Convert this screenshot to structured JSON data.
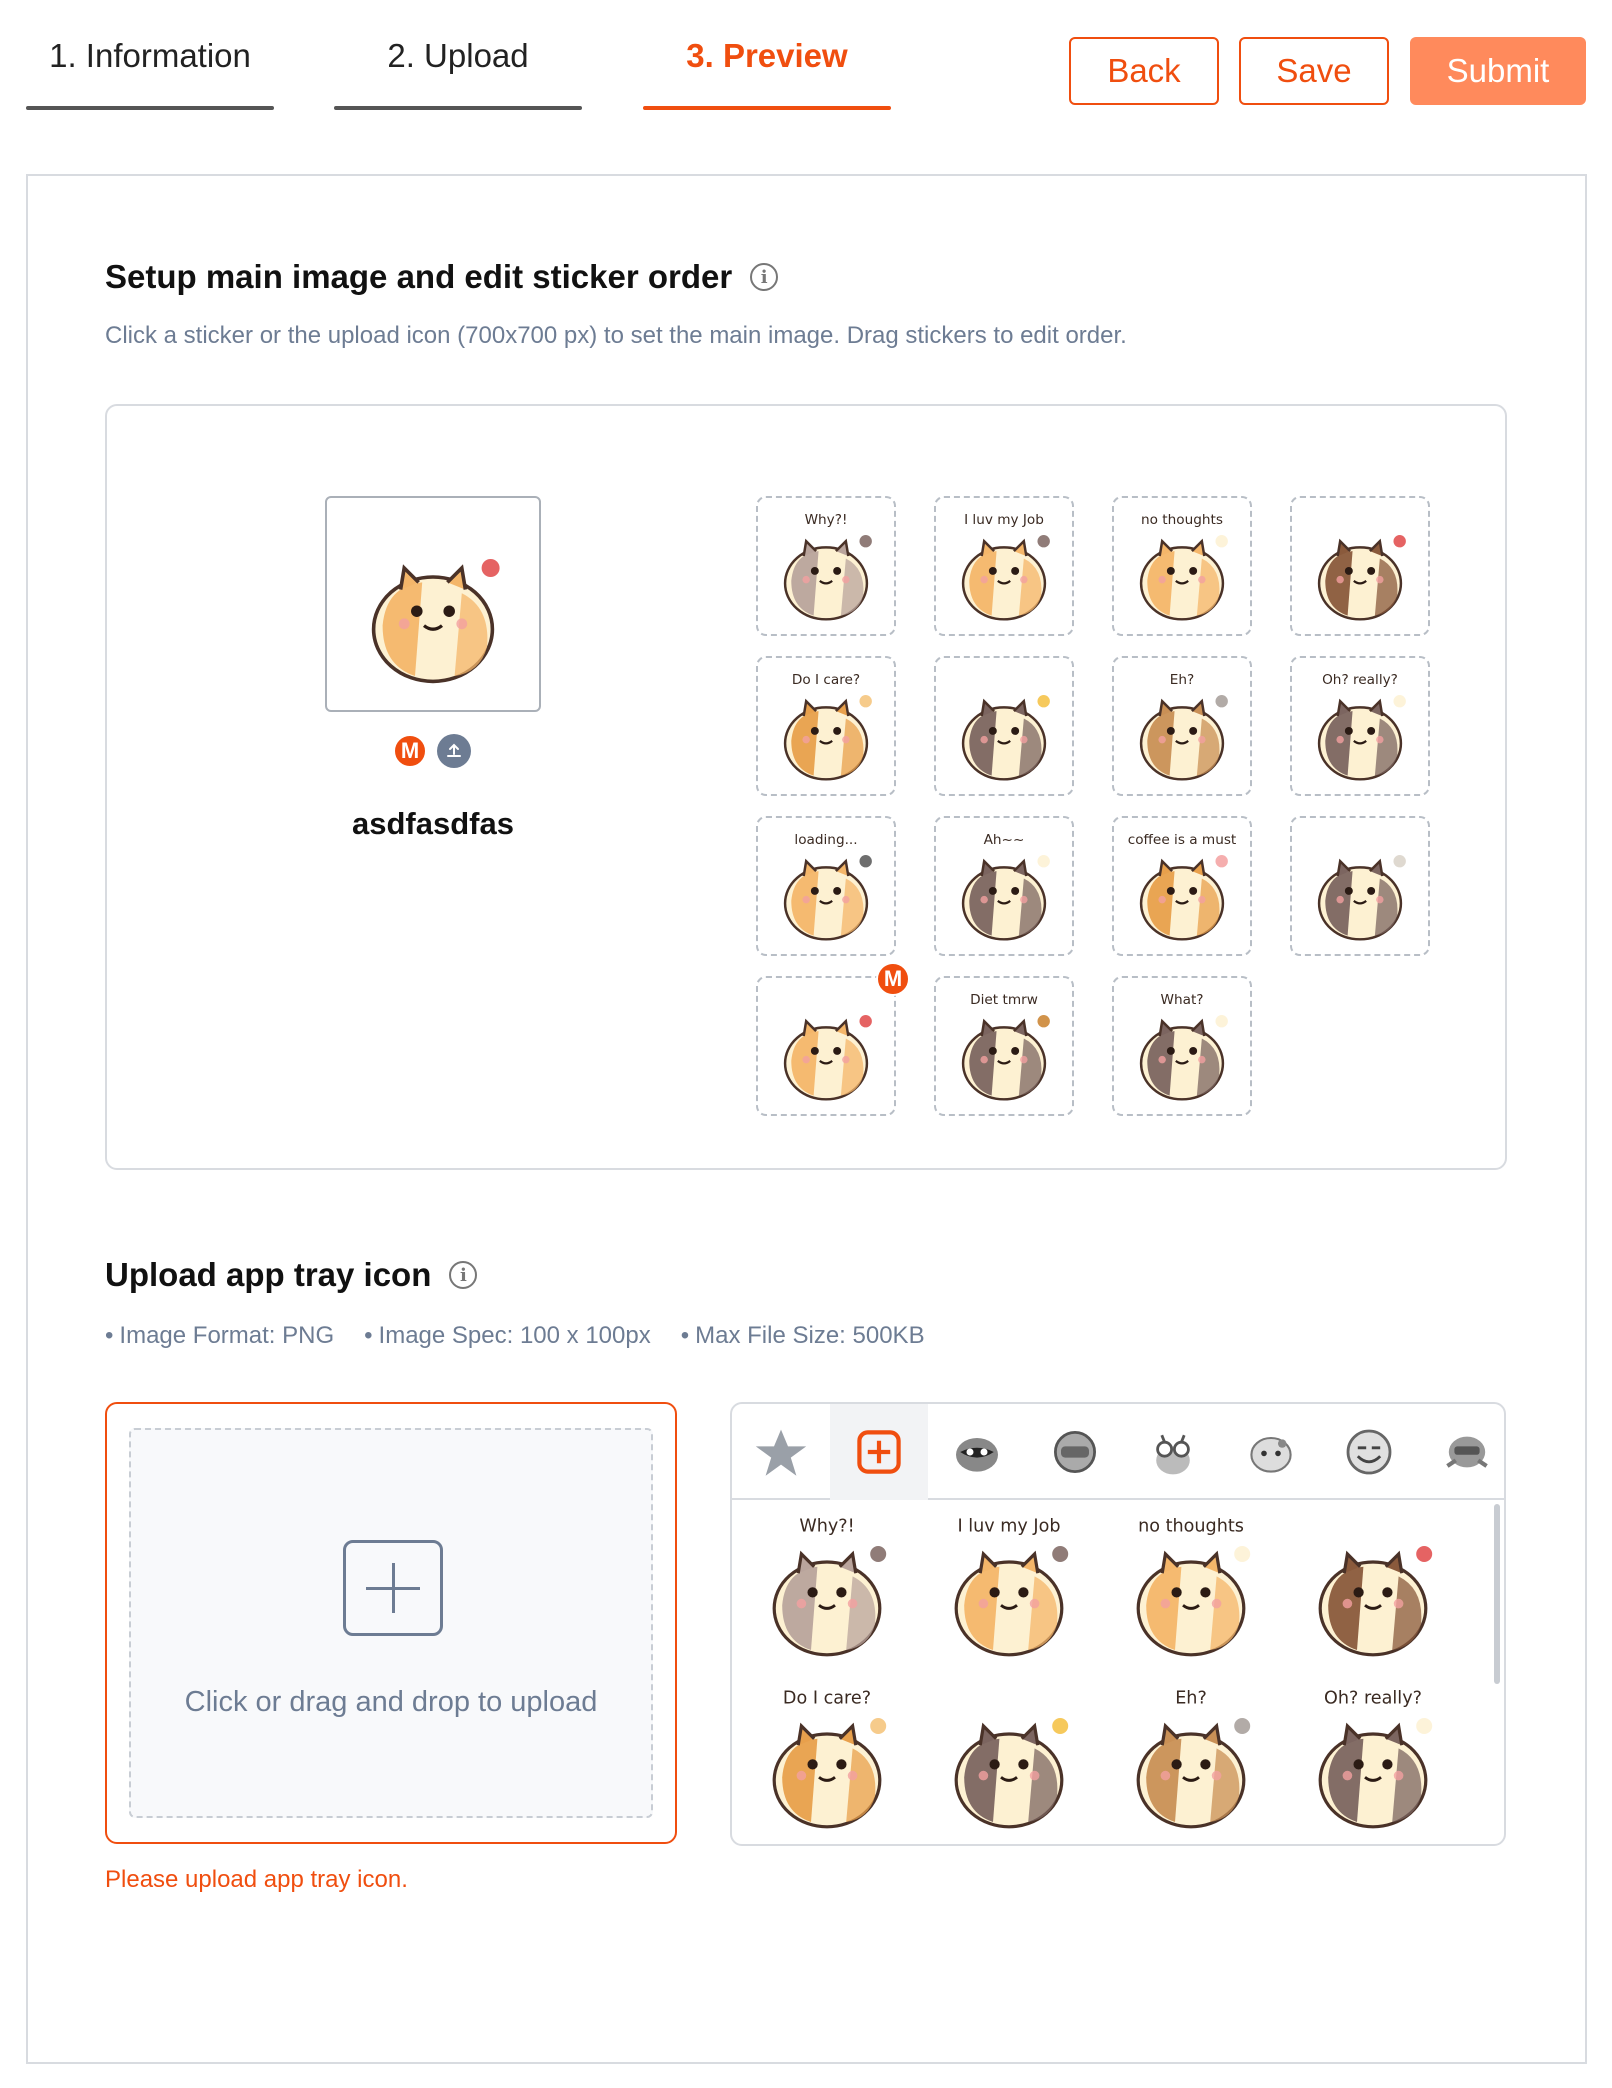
{
  "steps": [
    {
      "label": "1. Information",
      "active": false
    },
    {
      "label": "2. Upload",
      "active": false
    },
    {
      "label": "3. Preview",
      "active": true
    }
  ],
  "actions": {
    "back": "Back",
    "save": "Save",
    "submit": "Submit"
  },
  "setup": {
    "title": "Setup main image and edit sticker order",
    "subtitle": "Click a sticker or the upload icon (700x700 px) to set the main image. Drag stickers to edit order.",
    "main_badge": "M",
    "sticker_name": "asdfasdfas",
    "stickers": [
      {
        "caption": "Why?!",
        "body": "#b9a49c",
        "accent": "#7c6560"
      },
      {
        "caption": "I luv my Job",
        "body": "#f4b66a",
        "accent": "#7c6560"
      },
      {
        "caption": "no thoughts",
        "body": "#f4b66a",
        "accent": "#fdf1d2"
      },
      {
        "caption": "",
        "body": "#8a5a3c",
        "accent": "#e04848"
      },
      {
        "caption": "Do I care?",
        "body": "#e8a04c",
        "accent": "#f4c277"
      },
      {
        "caption": "",
        "body": "#7c6560",
        "accent": "#f4c040"
      },
      {
        "caption": "Eh?",
        "body": "#c99056",
        "accent": "#a59c98"
      },
      {
        "caption": "Oh? really?",
        "body": "#7c6560",
        "accent": "#fdf1d2"
      },
      {
        "caption": "loading...",
        "body": "#f4b66a",
        "accent": "#555555"
      },
      {
        "caption": "Ah~~",
        "body": "#7c6560",
        "accent": "#fdf1d2"
      },
      {
        "caption": "coffee is a must",
        "body": "#e8a04c",
        "accent": "#f3a0a0"
      },
      {
        "caption": "",
        "body": "#7c6560",
        "accent": "#d9d2c8"
      },
      {
        "caption": "",
        "body": "#f4b66a",
        "accent": "#e04848",
        "is_main": true
      },
      {
        "caption": "Diet tmrw",
        "body": "#7c6560",
        "accent": "#c9802c"
      },
      {
        "caption": "What?",
        "body": "#7c6560",
        "accent": "#fdf1d2"
      }
    ]
  },
  "tray": {
    "title": "Upload app tray icon",
    "specs": [
      "Image Format: PNG",
      "Image Spec: 100 x 100px",
      "Max File Size: 500KB"
    ],
    "upload_text": "Click or drag and drop to upload",
    "error": "Please upload app tray icon.",
    "tabs": [
      "star-icon",
      "add-icon",
      "raccoon-icon",
      "helmet-icon",
      "bug-eyes-icon",
      "cat-icon",
      "smile-icon",
      "robot-icon"
    ],
    "preview_stickers": [
      {
        "caption": "Why?!",
        "body": "#b9a49c",
        "accent": "#7c6560"
      },
      {
        "caption": "I luv my Job",
        "body": "#f4b66a",
        "accent": "#7c6560"
      },
      {
        "caption": "no thoughts",
        "body": "#f4b66a",
        "accent": "#fdf1d2"
      },
      {
        "caption": "",
        "body": "#8a5a3c",
        "accent": "#e04848"
      },
      {
        "caption": "Do I care?",
        "body": "#e8a04c",
        "accent": "#f4c277"
      },
      {
        "caption": "",
        "body": "#7c6560",
        "accent": "#f4c040"
      },
      {
        "caption": "Eh?",
        "body": "#c99056",
        "accent": "#a59c98"
      },
      {
        "caption": "Oh? really?",
        "body": "#7c6560",
        "accent": "#fdf1d2"
      }
    ]
  },
  "colors": {
    "brand": "#f04e0f",
    "submit": "#ff8a5c",
    "muted": "#6d7c93"
  }
}
